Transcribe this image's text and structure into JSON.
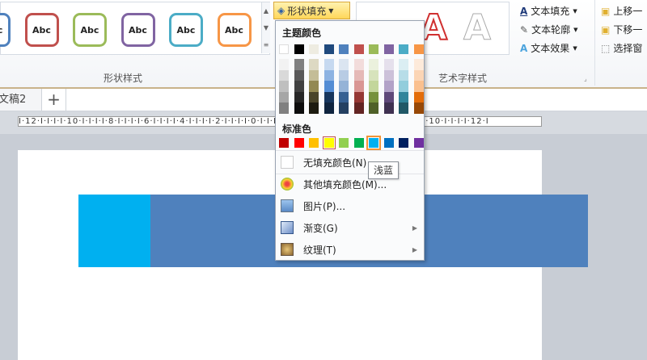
{
  "ribbon": {
    "gallery_items": [
      "Abc",
      "Abc",
      "Abc",
      "Abc",
      "Abc",
      "Abc"
    ],
    "gallery_colors": [
      "#4f81bd",
      "#c0504d",
      "#9bbb59",
      "#8064a2",
      "#4bacc6",
      "#f79646"
    ],
    "shape_styles_label": "形状样式",
    "shape_fill_button": "形状填充",
    "wordart_label": "艺术字样式",
    "text_fill": "文本填充",
    "text_outline": "文本轮廓",
    "text_effects": "文本效果",
    "bring_forward": "上移一",
    "send_backward": "下移一",
    "selection_pane": "选择窗"
  },
  "tabs": {
    "doc_tab": "文稿2",
    "add_tab": "+"
  },
  "ruler": {
    "text": "I·12·I·I·I·I·10·I·I·I·I·8·I·I·I·I·6·I·I·I·I·4·I·I·I·I·2·I·I·I·I·0·I·I·I·I·2·I·I·I·I·4·I·I·I·I·6·I·I·I·I·8·I·I·I·I·10·I·I·I·I·12·I"
  },
  "menu": {
    "theme_colors_label": "主题颜色",
    "theme_colors": [
      [
        "#ffffff",
        "#f2f2f2",
        "#d9d9d9",
        "#bfbfbf",
        "#a6a6a6",
        "#808080"
      ],
      [
        "#000000",
        "#808080",
        "#595959",
        "#404040",
        "#262626",
        "#0d0d0d"
      ],
      [
        "#eeece1",
        "#ddd9c3",
        "#c4bd97",
        "#938953",
        "#494429",
        "#1d1b10"
      ],
      [
        "#1f497d",
        "#c6d9f0",
        "#8db3e2",
        "#548dd4",
        "#17365d",
        "#0f243e"
      ],
      [
        "#4f81bd",
        "#dbe5f1",
        "#b8cce4",
        "#95b3d7",
        "#366092",
        "#244061"
      ],
      [
        "#c0504d",
        "#f2dcdb",
        "#e5b9b7",
        "#d99694",
        "#953734",
        "#632423"
      ],
      [
        "#9bbb59",
        "#ebf1dd",
        "#d7e3bc",
        "#c3d69b",
        "#76923c",
        "#4f6128"
      ],
      [
        "#8064a2",
        "#e5e0ec",
        "#ccc1d9",
        "#b2a2c7",
        "#5f497a",
        "#3f3151"
      ],
      [
        "#4bacc6",
        "#dbeef3",
        "#b7dde8",
        "#92cddc",
        "#31859b",
        "#205867"
      ],
      [
        "#f79646",
        "#fdeada",
        "#fbd5b5",
        "#fac08f",
        "#e36c09",
        "#974806"
      ]
    ],
    "standard_colors_label": "标准色",
    "standard_colors": [
      "#c00000",
      "#ff0000",
      "#ffc000",
      "#ffff00",
      "#92d050",
      "#00b050",
      "#00b0f0",
      "#0070c0",
      "#002060",
      "#7030a0"
    ],
    "current_index": 3,
    "hover_index": 6,
    "no_fill": "无填充颜色(N)",
    "more_colors": "其他填充颜色(M)...",
    "picture": "图片(P)...",
    "gradient": "渐变(G)",
    "texture": "纹理(T)"
  },
  "tooltip": "浅蓝",
  "slide": {
    "shape_left_color": "#00b0f0",
    "shape_right_color": "#4f81bd"
  }
}
